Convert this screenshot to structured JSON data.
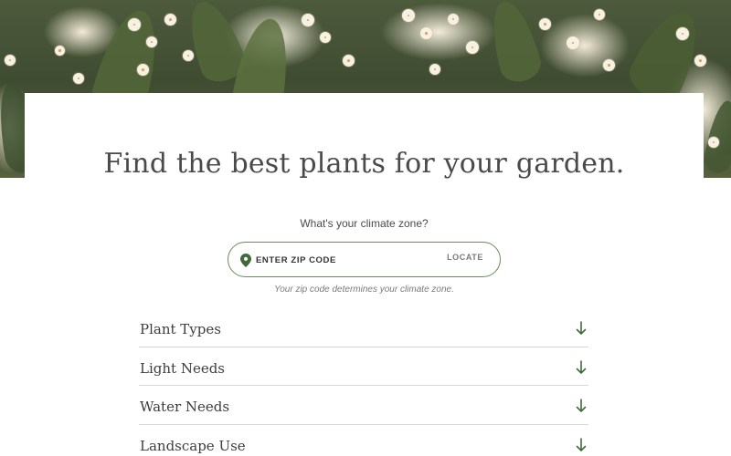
{
  "hero": {
    "image": "white-flowering-shrub-photo"
  },
  "title": "Find the best plants for your garden.",
  "climate": {
    "question": "What's your climate zone?",
    "zip_placeholder": "ENTER ZIP CODE",
    "locate_label": "LOCATE",
    "hint": "Your zip code determines your climate zone."
  },
  "filters": [
    {
      "label": "Plant Types"
    },
    {
      "label": "Light Needs"
    },
    {
      "label": "Water Needs"
    },
    {
      "label": "Landscape Use"
    }
  ],
  "icons": {
    "location": "map-pin-icon",
    "expand": "arrow-down-icon"
  },
  "colors": {
    "accent": "#3f6b3a",
    "border": "#6b8a5b",
    "text": "#3d3d3d",
    "muted": "#7a7a7a"
  }
}
